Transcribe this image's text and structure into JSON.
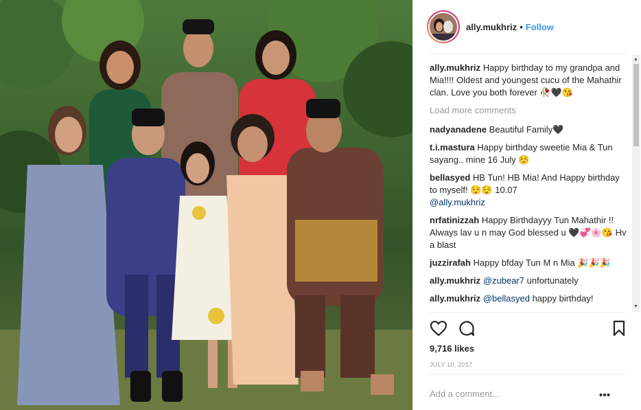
{
  "header": {
    "username": "ally.mukhriz",
    "separator": "•",
    "follow_label": "Follow"
  },
  "caption": {
    "username": "ally.mukhriz",
    "text": "Happy birthday to my grandpa and Mia!!!! Oldest and youngest cucu of the Mahathir clan. Love you both forever 🥀🖤😘"
  },
  "load_more_label": "Load more comments",
  "comments": [
    {
      "username": "nadyanadene",
      "text": "Beautiful Family🖤"
    },
    {
      "username": "t.i.mastura",
      "text": "Happy birthday sweetie Mia & Tun sayang.. mine 16 July ☺️"
    },
    {
      "username": "bellasyed",
      "text": "HB Tun! HB Mia! And Happy birthday to myself! 😌😌 10.07",
      "mention": "@ally.mukhriz"
    },
    {
      "username": "nrfatinizzah",
      "text": "Happy Birthdayyy Tun Mahathir !! Always lav u n may God blessed u 🖤💞🌸😘 Hv a blast"
    },
    {
      "username": "juzzirafah",
      "text": "Happy bfday Tun M n Mia 🎉🎉🎉"
    },
    {
      "username": "ally.mukhriz",
      "mention": "@zubear7",
      "text": "unfortunately"
    },
    {
      "username": "ally.mukhriz",
      "mention": "@bellasyed",
      "text": "happy birthday!"
    }
  ],
  "icons": {
    "like": "heart-icon",
    "comment": "comment-icon",
    "save": "bookmark-icon",
    "more": "more-options-icon"
  },
  "likes": "9,716 likes",
  "date": "JULY 10, 2017",
  "add_comment_placeholder": "Add a comment..."
}
